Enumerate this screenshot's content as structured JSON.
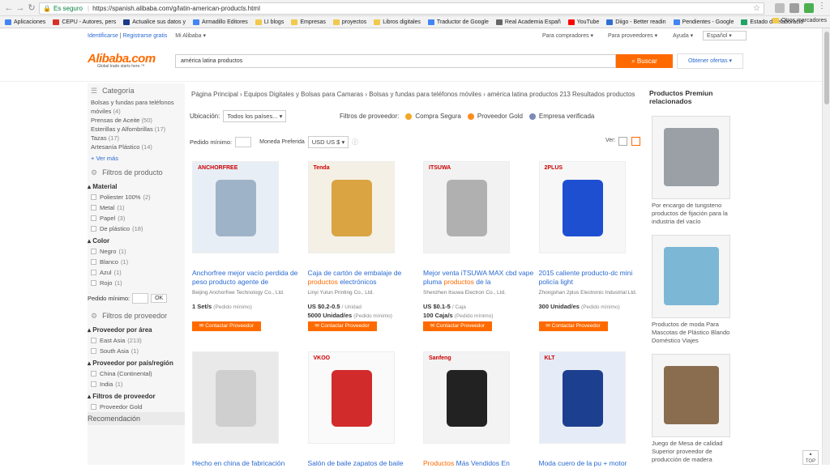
{
  "browser": {
    "security_label": "Es seguro",
    "url": "https://spanish.alibaba.com/g/latin-american-products.html",
    "bookmarks": [
      {
        "label": "Aplicaciones",
        "color": "#4285f4"
      },
      {
        "label": "CEPU - Autores, pers",
        "color": "#d93025"
      },
      {
        "label": "Actualice sus datos y",
        "color": "#1a3a8a"
      },
      {
        "label": "Armadillo Editores",
        "color": "#4285f4"
      },
      {
        "label": "LI blogs",
        "color": "#f2c94c"
      },
      {
        "label": "Empresas",
        "color": "#f2c94c"
      },
      {
        "label": "proyectos",
        "color": "#f2c94c"
      },
      {
        "label": "Libros digitales",
        "color": "#f2c94c"
      },
      {
        "label": "Traductor de Google",
        "color": "#4285f4"
      },
      {
        "label": "Real Academia Españ",
        "color": "#666666"
      },
      {
        "label": "YouTube",
        "color": "#ff0000"
      },
      {
        "label": "Diigo - Better readin",
        "color": "#2d6fd1"
      },
      {
        "label": "Pendientes - Google",
        "color": "#4285f4"
      },
      {
        "label": "Estado de elaboració",
        "color": "#1fa463"
      }
    ],
    "other_bookmarks": "Otros marcadores"
  },
  "topnav": {
    "signin": "Identificarse",
    "register": "Registrarse gratis",
    "my_alibaba": "Mi Alibaba",
    "buyers": "Para compradores",
    "suppliers": "Para proveedores",
    "help": "Ayuda",
    "language": "Español"
  },
  "header": {
    "logo": "Alibaba.com",
    "logo_tag": "Global trade starts here.™",
    "search_value": "américa latina productos",
    "search_button": "Buscar",
    "offers_button": "Obtener ofertas ▾"
  },
  "sidebar": {
    "category_heading": "Categoría",
    "categories": [
      {
        "label": "Bolsas y fundas para teléfonos móviles",
        "count": "(4)"
      },
      {
        "label": "Prensas de Aceite",
        "count": "(50)"
      },
      {
        "label": "Esterillas y Alfombrillas",
        "count": "(17)"
      },
      {
        "label": "Tazas",
        "count": "(17)"
      },
      {
        "label": "Artesanía Plástico",
        "count": "(14)"
      }
    ],
    "more": "+ Ver más",
    "product_filters": "Filtros de producto",
    "material_title": "Material",
    "materials": [
      {
        "label": "Poliester 100%",
        "count": "(2)"
      },
      {
        "label": "Metal",
        "count": "(1)"
      },
      {
        "label": "Papel",
        "count": "(3)"
      },
      {
        "label": "De plástico",
        "count": "(18)"
      }
    ],
    "color_title": "Color",
    "colors": [
      {
        "label": "Negro",
        "count": "(1)"
      },
      {
        "label": "Blanco",
        "count": "(1)"
      },
      {
        "label": "Azul",
        "count": "(1)"
      },
      {
        "label": "Rojo",
        "count": "(1)"
      }
    ],
    "min_order_label": "Pedido mínimo:",
    "ok": "OK",
    "supplier_filters": "Filtros de proveedor",
    "area_title": "Proveedor por área",
    "areas": [
      {
        "label": "East Asia",
        "count": "(213)"
      },
      {
        "label": "South Asia",
        "count": "(1)"
      }
    ],
    "country_title": "Proveedor por país/región",
    "countries": [
      {
        "label": "China (Continental)",
        "count": ""
      },
      {
        "label": "India",
        "count": "(1)"
      }
    ],
    "supplier_filter_title": "Filtros de proveedor",
    "gold_supplier": "Proveedor Gold",
    "recommendation": "Recomendación"
  },
  "main": {
    "breadcrumb": "Página Principal › Equipos Digitales y Bolsas para Camaras › Bolsas y fundas para teléfonos móviles › américa latina productos 213 Resultados productos",
    "location_label": "Ubicación:",
    "location_value": "Todos los países...",
    "supplier_filters_label": "Filtros de proveedor:",
    "secure_trade": "Compra Segura",
    "gold_supplier": "Proveedor Gold",
    "verified": "Empresa verificada",
    "min_order_label": "Pedido mínimo:",
    "currency_label": "Moneda Preferida",
    "currency_value": "USD US $",
    "view_label": "Ver:",
    "contact_button": "Contactar Proveedor",
    "products": [
      {
        "title_a": "Anchorfree mejor vacío perdida de peso producto agente de",
        "title_hl": "",
        "title_b": "",
        "company": "Beijing Anchorfree Technology Co., Ltd.",
        "price": "",
        "unit": "",
        "moq": "1 Set/s",
        "moq_note": "(Pedido mínimo)",
        "img_text": "ANCHORFREE"
      },
      {
        "title_a": "Caja de cartón de embalaje de ",
        "title_hl": "productos",
        "title_b": " electrónicos",
        "company": "Linyi Yulun Printing Co., Ltd.",
        "price": "US $0.2-0.5",
        "unit": "/ Unidad",
        "moq": "5000 Unidad/es",
        "moq_note": "(Pedido mínimo)",
        "img_text": "Tenda"
      },
      {
        "title_a": "Mejor venta iTSUWA MAX cbd vape pluma ",
        "title_hl": "productos",
        "title_b": " de la",
        "company": "Shenzhen Itsuwa Electron Co., Ltd.",
        "price": "US $0.1-5",
        "unit": "/ Caja",
        "moq": "100 Caja/s",
        "moq_note": "(Pedido mínimo)",
        "img_text": "ITSUWA"
      },
      {
        "title_a": "2015 caliente producto-dc mini policía light",
        "title_hl": "",
        "title_b": "",
        "company": "Zhongshan 2plus Electronic Industrial Ltd.",
        "price": "",
        "unit": "",
        "moq": "300 Unidad/es",
        "moq_note": "(Pedido mínimo)",
        "img_text": "2PLUS"
      },
      {
        "title_a": "Hecho en china de fabricación",
        "title_hl": "",
        "title_b": "",
        "img_text": ""
      },
      {
        "title_a": "Salón de baile zapatos de baile",
        "title_hl": "",
        "title_b": "",
        "img_text": "VKOO"
      },
      {
        "title_a": "",
        "title_hl": "Productos",
        "title_b": " Más Vendidos En",
        "img_text": "Sanfeng"
      },
      {
        "title_a": "Moda cuero de la pu + motor",
        "title_hl": "",
        "title_b": "",
        "img_text": "KLT"
      }
    ]
  },
  "premium": {
    "title": "Productos Premiun relacionados",
    "items": [
      "Por encargo de tungsteno productos de fijación para la industria del vacío",
      "Productos de moda Para Mascotas de Plástico Blando Doméstico Viajes",
      "Juego de Mesa de calidad Superior proveedor de producción de madera"
    ]
  },
  "top_button": "TOP"
}
